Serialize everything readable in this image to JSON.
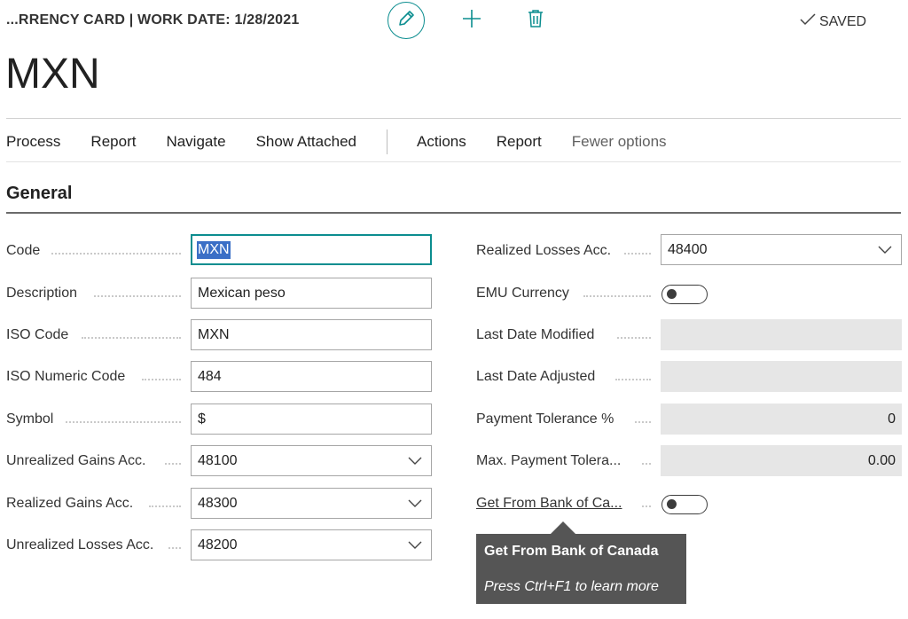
{
  "header": {
    "breadcrumb": "...RRENCY CARD | WORK DATE: 1/28/2021",
    "saved_label": "SAVED",
    "title": "MXN",
    "icons": [
      "pencil-icon",
      "plus-icon",
      "trash-icon",
      "check-icon"
    ]
  },
  "menu": {
    "items": [
      "Process",
      "Report",
      "Navigate",
      "Show Attached"
    ],
    "items_right": [
      "Actions",
      "Report"
    ],
    "fewer_options": "Fewer options"
  },
  "section": {
    "title": "General"
  },
  "left_fields": [
    {
      "label": "Code",
      "value": "MXN"
    },
    {
      "label": "Description",
      "value": "Mexican peso"
    },
    {
      "label": "ISO Code",
      "value": "MXN"
    },
    {
      "label": "ISO Numeric Code",
      "value": "484"
    },
    {
      "label": "Symbol",
      "value": "$"
    },
    {
      "label": "Unrealized Gains Acc.",
      "value": "48100"
    },
    {
      "label": "Realized Gains Acc.",
      "value": "48300"
    },
    {
      "label": "Unrealized Losses Acc.",
      "value": "48200"
    }
  ],
  "right_fields": [
    {
      "label": "Realized Losses Acc.",
      "value": "48400"
    },
    {
      "label": "EMU Currency",
      "value": ""
    },
    {
      "label": "Last Date Modified",
      "value": ""
    },
    {
      "label": "Last Date Adjusted",
      "value": ""
    },
    {
      "label": "Payment Tolerance %",
      "value": "0"
    },
    {
      "label": "Max. Payment Tolera...",
      "value": "0.00"
    },
    {
      "label": "Get From Bank of Ca...",
      "value": ""
    }
  ],
  "tooltip": {
    "title": "Get From Bank of Canada",
    "hint": "Press Ctrl+F1 to learn more"
  },
  "colors": {
    "accent": "#0b8d8f",
    "selection": "#3b6fc6",
    "tooltip_bg": "#555555",
    "readonly_bg": "#e6e6e6"
  }
}
